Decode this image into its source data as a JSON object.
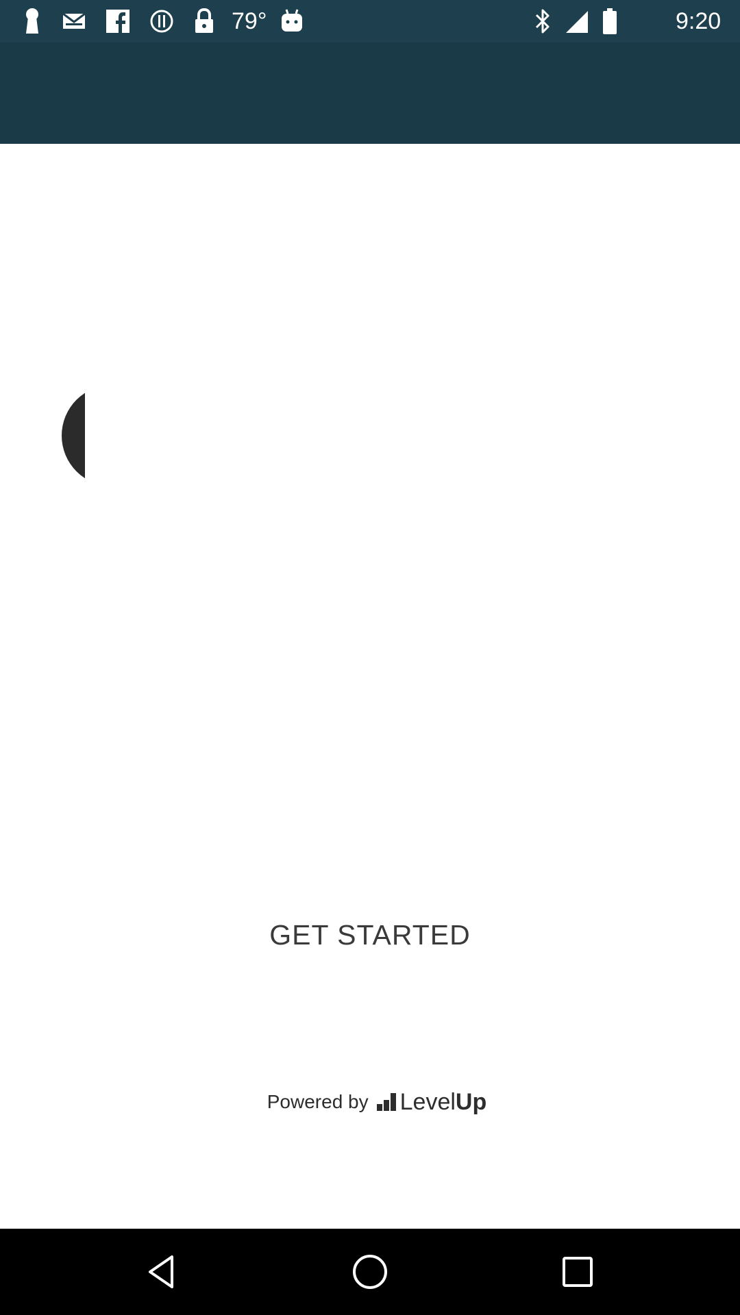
{
  "status_bar": {
    "temperature": "79°",
    "time": "9:20",
    "left_icons": [
      "keyhole-icon",
      "inbox-icon",
      "facebook-icon",
      "info-circle-icon",
      "lock-icon"
    ],
    "temp_side_icon": "android-icon",
    "right_icons": [
      "bluetooth-icon",
      "signal-icon",
      "battery-icon"
    ]
  },
  "main": {
    "loading_indicator": "spinner-arc",
    "get_started_label": "GET STARTED"
  },
  "footer": {
    "powered_by": "Powered by",
    "brand_level": "Level",
    "brand_up": "Up"
  },
  "nav_bar": {
    "buttons": [
      "back-icon",
      "home-icon",
      "recents-icon"
    ]
  },
  "colors": {
    "status_bar": "#1e3f4d",
    "app_bar": "#1a3a47",
    "background": "#ffffff",
    "nav_bar": "#000000",
    "text_dark": "#3a3a3a"
  }
}
